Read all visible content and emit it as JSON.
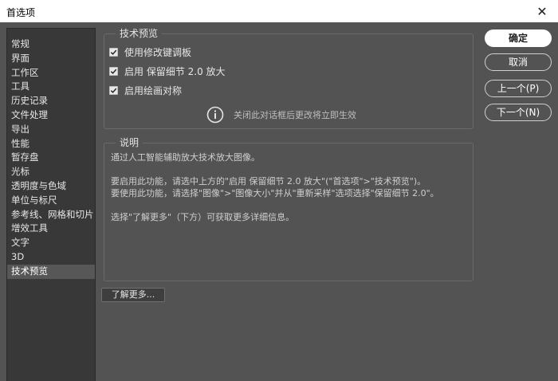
{
  "window": {
    "title": "首选项"
  },
  "sidebar": {
    "items": [
      {
        "label": "常规"
      },
      {
        "label": "界面"
      },
      {
        "label": "工作区"
      },
      {
        "label": "工具"
      },
      {
        "label": "历史记录"
      },
      {
        "label": "文件处理"
      },
      {
        "label": "导出"
      },
      {
        "label": "性能"
      },
      {
        "label": "暂存盘"
      },
      {
        "label": "光标"
      },
      {
        "label": "透明度与色域"
      },
      {
        "label": "单位与标尺"
      },
      {
        "label": "参考线、网格和切片"
      },
      {
        "label": "增效工具"
      },
      {
        "label": "文字"
      },
      {
        "label": "3D"
      },
      {
        "label": "技术预览"
      }
    ],
    "selected": "技术预览"
  },
  "tech_preview": {
    "legend": "技术预览",
    "options": [
      {
        "label": "使用修改键调板",
        "checked": true
      },
      {
        "label": "启用 保留细节 2.0 放大",
        "checked": true
      },
      {
        "label": "启用绘画对称",
        "checked": true
      }
    ],
    "notice": "关闭此对话框后更改将立即生效",
    "notice_icon": "info-icon"
  },
  "description": {
    "legend": "说明",
    "line1": "通过人工智能辅助放大技术放大图像。",
    "line2": "要启用此功能，请选中上方的\"启用 保留细节 2.0 放大\"(\"首选项\">\"技术预览\")。",
    "line3": "要使用此功能，请选择\"图像\">\"图像大小\"并从\"重新采样\"选项选择\"保留细节 2.0\"。",
    "line4": "选择\"了解更多\"（下方）可获取更多详细信息。"
  },
  "learn_more": {
    "label": "了解更多..."
  },
  "buttons": {
    "ok": "确定",
    "cancel": "取消",
    "prev": "上一个(P)",
    "next": "下一个(N)"
  },
  "colors": {
    "dialog_bg": "#535353",
    "sidebar_bg": "#383838",
    "sidebar_selected": "#575757",
    "primary_button": "#ffffff"
  }
}
